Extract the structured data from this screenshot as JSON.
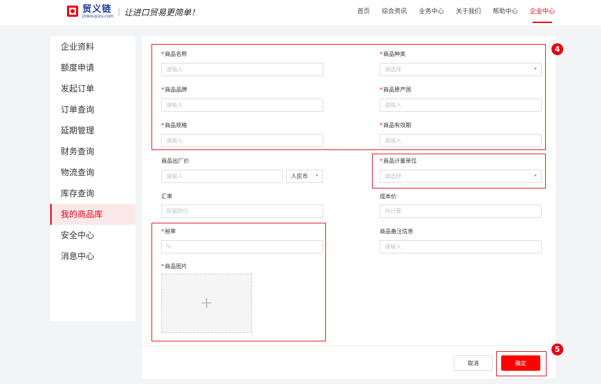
{
  "header": {
    "logo_name": "贸义链",
    "logo_domain": "jinkouyizu.com",
    "slogan": "让进口贸易更简单！",
    "nav": [
      "首页",
      "综合资讯",
      "业务中心",
      "关于我们",
      "帮助中心",
      "企业中心"
    ],
    "active_nav": "企业中心"
  },
  "sidebar": {
    "items": [
      "企业资料",
      "额度申请",
      "发起订单",
      "订单查询",
      "延期管理",
      "财务查询",
      "物流查询",
      "库存查询",
      "我的商品库",
      "安全中心",
      "消息中心"
    ],
    "active": "我的商品库"
  },
  "form": {
    "required_mark": "*",
    "product_name": {
      "label": "商品名称",
      "placeholder": "请输入"
    },
    "product_category": {
      "label": "商品种类",
      "placeholder": "请选择"
    },
    "brand": {
      "label": "商品品牌",
      "placeholder": "请输入"
    },
    "origin": {
      "label": "商品原产国",
      "placeholder": "请输入"
    },
    "spec": {
      "label": "商品规格",
      "placeholder": "请输入"
    },
    "validity": {
      "label": "商品有效期",
      "placeholder": "请输入"
    },
    "factory_price": {
      "label": "商品出厂价",
      "placeholder": "请输入",
      "currency": "人民币"
    },
    "unit": {
      "label": "商品计量单位",
      "placeholder": "请选择"
    },
    "exchange_rate": {
      "label": "汇率",
      "placeholder": "保留四位"
    },
    "cost_price": {
      "label": "成本价",
      "placeholder": "待计算"
    },
    "tax_rate": {
      "label": "税率",
      "placeholder": "%"
    },
    "remark": {
      "label": "商品备注信息",
      "placeholder": "请输入"
    },
    "image": {
      "label": "商品图片",
      "plus": "+"
    }
  },
  "buttons": {
    "cancel": "取消",
    "confirm": "确定"
  },
  "badges": {
    "step4": "4",
    "step5": "5"
  },
  "colors": {
    "accent": "#e60012",
    "brand_blue": "#1d3b9c",
    "confirm_button": "#ff0000"
  },
  "icons": {
    "select_arrow": "caret-down-icon",
    "upload": "plus-icon"
  }
}
